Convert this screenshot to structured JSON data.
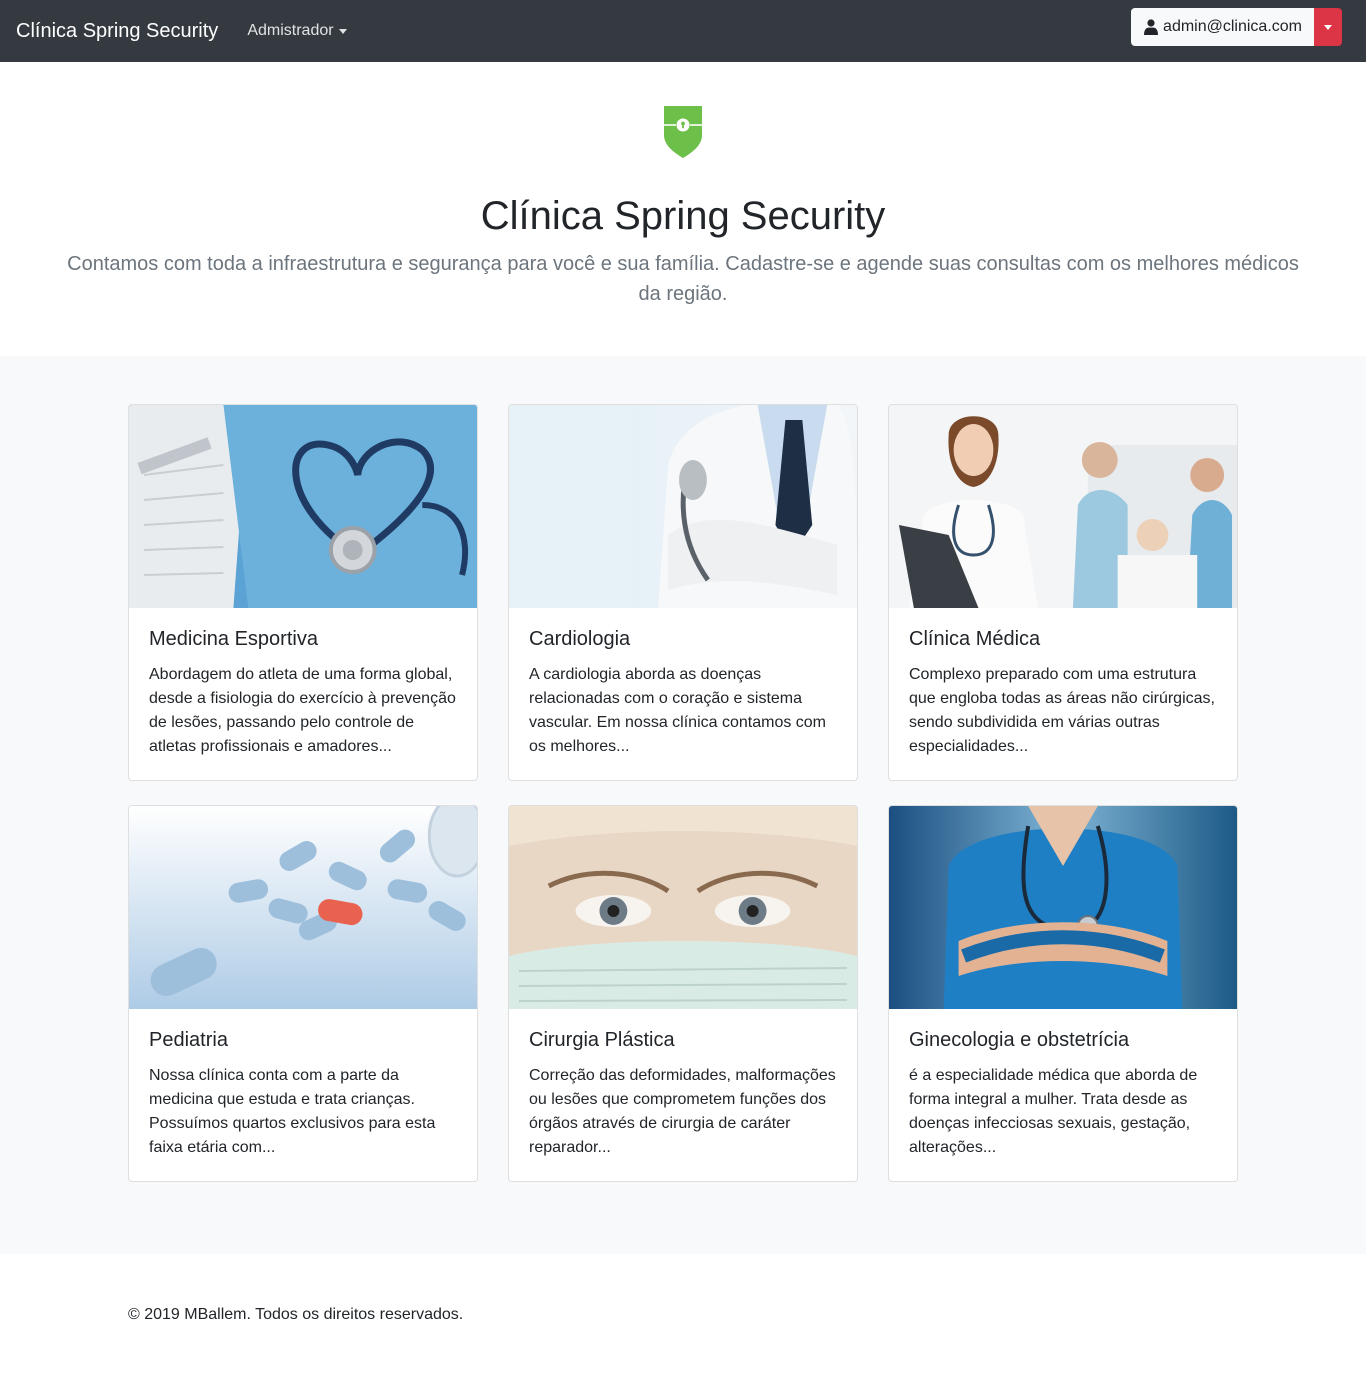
{
  "navbar": {
    "brand": "Clínica Spring Security",
    "menu_label": "Admistrador",
    "user_email": "admin@clinica.com",
    "icons": [
      "user-icon",
      "caret-down-icon"
    ],
    "colors": {
      "background": "#343a40",
      "split_button": "#dc3545"
    }
  },
  "hero": {
    "logo": "shield-keyhole-icon",
    "logo_color": "#6cc04a",
    "title": "Clínica Spring Security",
    "lead": "Contamos com toda a infraestrutura e segurança para você e sua família. Cadastre-se e agende suas consultas com os melhores médicos da região."
  },
  "cards": [
    {
      "title": "Medicina Esportiva",
      "text": "Abordagem do atleta de uma forma global, desde a fisiologia do exercício à prevenção de lesões, passando pelo controle de atletas profissionais e amadores...",
      "image": "stethoscope-heart-photo"
    },
    {
      "title": "Cardiologia",
      "text": "A cardiologia aborda as doenças relacionadas com o coração e sistema vascular. Em nossa clínica contamos com os melhores...",
      "image": "doctor-white-coat-photo"
    },
    {
      "title": "Clínica Médica",
      "text": "Complexo preparado com uma estrutura que engloba todas as áreas não cirúrgicas, sendo subdividida em várias outras especialidades...",
      "image": "female-doctor-clinic-photo"
    },
    {
      "title": "Pediatria",
      "text": "Nossa clínica conta com a parte da medicina que estuda e trata crianças. Possuímos quartos exclusivos para esta faixa etária com...",
      "image": "pills-photo"
    },
    {
      "title": "Cirurgia Plástica",
      "text": "Correção das deformidades, malformações ou lesões que comprometem funções dos órgãos através de cirurgia de caráter reparador...",
      "image": "surgeon-mask-photo"
    },
    {
      "title": "Ginecologia e obstetrícia",
      "text": "é a especialidade médica que aborda de forma integral a mulher. Trata desde as doenças infecciosas sexuais, gestação, alterações...",
      "image": "nurse-arms-crossed-photo"
    }
  ],
  "footer": {
    "copyright": "© 2019 MBallem. Todos os direitos reservados."
  }
}
